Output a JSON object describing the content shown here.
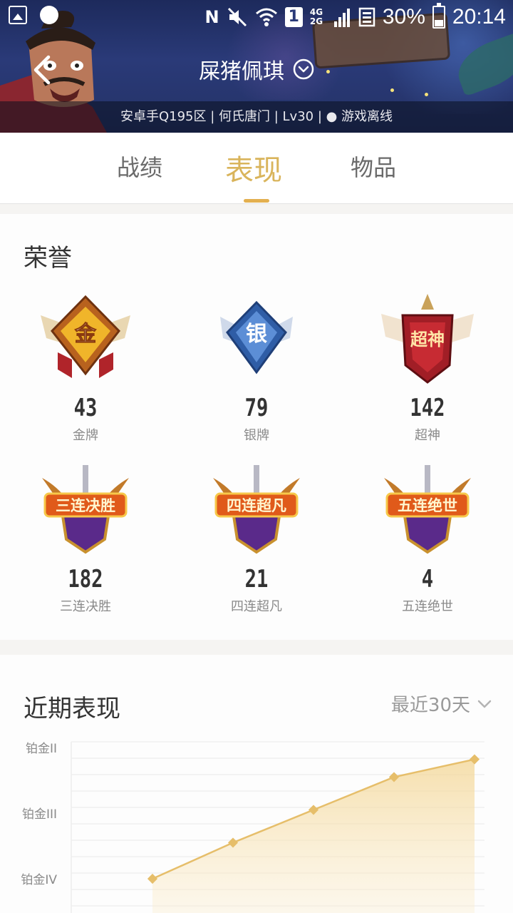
{
  "status_bar": {
    "battery": "30%",
    "time": "20:14",
    "network": "4G 2G",
    "sim": "1",
    "icons": [
      "gallery-icon",
      "dots-icon",
      "nfc-icon",
      "mute-icon",
      "wifi-icon",
      "sim-icon",
      "signal-icon",
      "data-icon",
      "battery-icon"
    ]
  },
  "header": {
    "player_name": "屎猪佩琪",
    "info": "安卓手Q195区 | 何氏唐门 | Lv30 | ● 游戏离线"
  },
  "tabs": [
    {
      "label": "战绩",
      "active": false
    },
    {
      "label": "表现",
      "active": true
    },
    {
      "label": "物品",
      "active": false
    }
  ],
  "honor": {
    "title": "荣誉",
    "badges": [
      {
        "emblem": "金",
        "count": "43",
        "label": "金牌",
        "icon": "gold-medal-icon"
      },
      {
        "emblem": "银",
        "count": "79",
        "label": "银牌",
        "icon": "silver-medal-icon"
      },
      {
        "emblem": "超神",
        "count": "142",
        "label": "超神",
        "icon": "legendary-badge-icon"
      },
      {
        "emblem": "三连决胜",
        "count": "182",
        "label": "三连决胜",
        "icon": "triple-kill-badge-icon"
      },
      {
        "emblem": "四连超凡",
        "count": "21",
        "label": "四连超凡",
        "icon": "quadra-kill-badge-icon"
      },
      {
        "emblem": "五连绝世",
        "count": "4",
        "label": "五连绝世",
        "icon": "penta-kill-badge-icon"
      }
    ]
  },
  "recent": {
    "title": "近期表现",
    "period": "最近30天"
  },
  "chart_data": {
    "type": "area",
    "y_categories": [
      "铂金IV",
      "铂金III",
      "铂金II"
    ],
    "points": [
      0.0,
      0.55,
      1.05,
      1.55,
      1.82
    ],
    "x_positions": [
      0,
      1,
      2,
      3,
      4
    ],
    "grid": true,
    "color": "#e6be6a"
  },
  "colors": {
    "accent": "#e3b04f",
    "tab_active": "#d9b45b",
    "text_dark": "#333333",
    "text_muted": "#8a8a8a"
  }
}
